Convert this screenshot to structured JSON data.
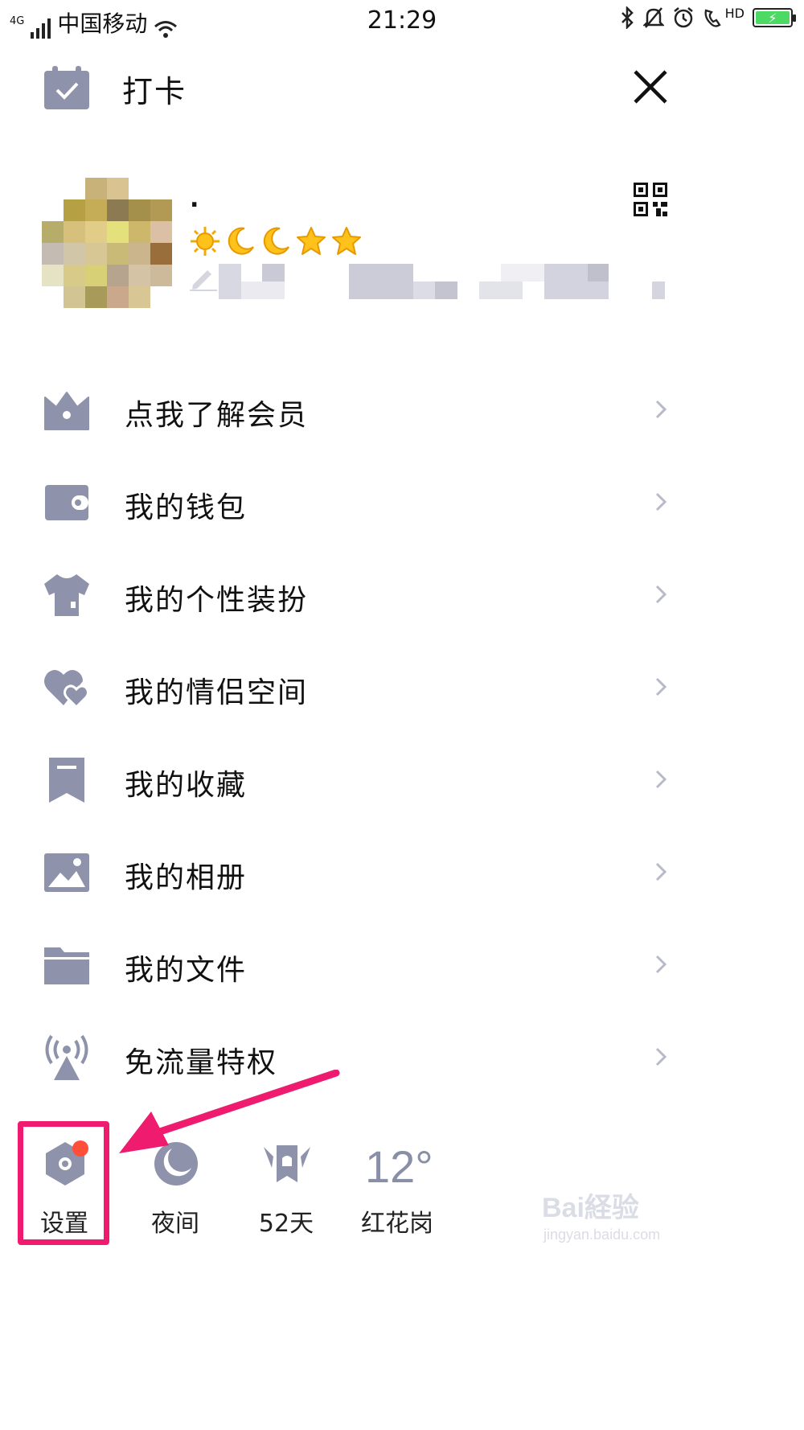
{
  "status_bar": {
    "network": "4G",
    "carrier": "中国移动",
    "time": "21:29",
    "hd_label": "HD"
  },
  "header": {
    "title": "打卡",
    "checkin_icon": "calendar-check-icon",
    "close_icon": "close-icon"
  },
  "profile": {
    "nickname": ".",
    "level_icons": [
      "sun-icon",
      "moon-icon",
      "moon-icon",
      "star-icon",
      "star-icon"
    ],
    "qr_icon": "qr-code-icon",
    "signature_icon": "pencil-icon"
  },
  "menu": [
    {
      "label": "点我了解会员",
      "icon": "crown-icon"
    },
    {
      "label": "我的钱包",
      "icon": "wallet-icon"
    },
    {
      "label": "我的个性装扮",
      "icon": "tshirt-icon"
    },
    {
      "label": "我的情侣空间",
      "icon": "hearts-icon"
    },
    {
      "label": "我的收藏",
      "icon": "bookmark-icon"
    },
    {
      "label": "我的相册",
      "icon": "photo-icon"
    },
    {
      "label": "我的文件",
      "icon": "folder-icon"
    },
    {
      "label": "免流量特权",
      "icon": "signal-tower-icon"
    }
  ],
  "bottom_bar": {
    "settings": "设置",
    "night": "夜间",
    "days": "52天",
    "temperature": "12°",
    "location": "红花岗"
  },
  "watermark": {
    "brand": "Bai経验",
    "url": "jingyan.baidu.com"
  },
  "colors": {
    "icon_gray": "#8e92aa",
    "highlight": "#ee1b6e",
    "badge": "#ff4e3a",
    "level_gold": "#f5b400"
  }
}
